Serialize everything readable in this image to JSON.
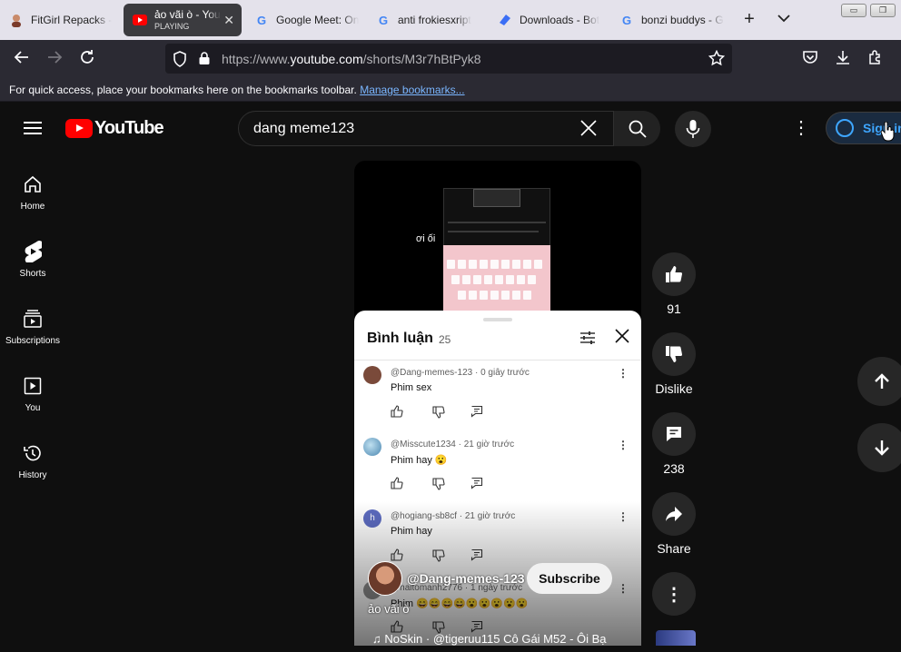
{
  "browser": {
    "tabs": [
      {
        "title": "FitGirl Repacks -",
        "icon": "fitgirl-icon"
      },
      {
        "title": "ảo vãi ò - You",
        "subtitle": "PLAYING",
        "icon": "youtube-icon",
        "active": true
      },
      {
        "title": "Google Meet: On",
        "icon": "google-icon"
      },
      {
        "title": "anti frokiesxript",
        "icon": "google-icon"
      },
      {
        "title": "Downloads - Bot",
        "icon": "discord-icon"
      },
      {
        "title": "bonzi buddys - G",
        "icon": "google-icon"
      }
    ],
    "url_prefix": "https://www.",
    "url_domain": "youtube.com",
    "url_path": "/shorts/M3r7hBtPyk8",
    "bookmarks_text": "For quick access, place your bookmarks here on the bookmarks toolbar.",
    "bookmarks_link": "Manage bookmarks..."
  },
  "youtube": {
    "logo_text": "YouTube",
    "search_query": "dang meme123",
    "signin_label": "Sign in",
    "sidebar": [
      {
        "label": "Home",
        "icon": "home-icon"
      },
      {
        "label": "Shorts",
        "icon": "shorts-icon"
      },
      {
        "label": "Subscriptions",
        "icon": "subscriptions-icon"
      },
      {
        "label": "You",
        "icon": "you-icon"
      },
      {
        "label": "History",
        "icon": "history-icon"
      }
    ],
    "video_overlay_text": "ơi ối",
    "comments_panel": {
      "title": "Bình luận",
      "count": "25",
      "comments": [
        {
          "author": "@Dang-memes-123",
          "time": "0 giây trước",
          "text": "Phim sex",
          "avatar_color": "#7a4a3a"
        },
        {
          "author": "@Misscute1234",
          "time": "21 giờ trước",
          "text": "Phim hay 😮",
          "avatar_color": "#6aa0c8"
        },
        {
          "author": "@hogiang-sb8cf",
          "time": "21 giờ trước",
          "text": "Phim hay",
          "avatar_letter": "h",
          "avatar_color": "#5c6bc0"
        },
        {
          "author": "@haitomanh2776",
          "time": "1 ngày trước",
          "text": "Phim 😄😄😄😄😮😮😮😮😮",
          "avatar_color": "#8a8a8a"
        }
      ]
    },
    "channel_name": "@Dang-memes-123",
    "subscribe_label": "Subscribe",
    "video_title": "ảo vãi ò",
    "music_text": "♫ NoSkin · @tigeruu115     Cô Gái M52 - Ôi Bạ",
    "actions": {
      "likes": "91",
      "dislike_label": "Dislike",
      "comments": "238",
      "share_label": "Share"
    }
  }
}
